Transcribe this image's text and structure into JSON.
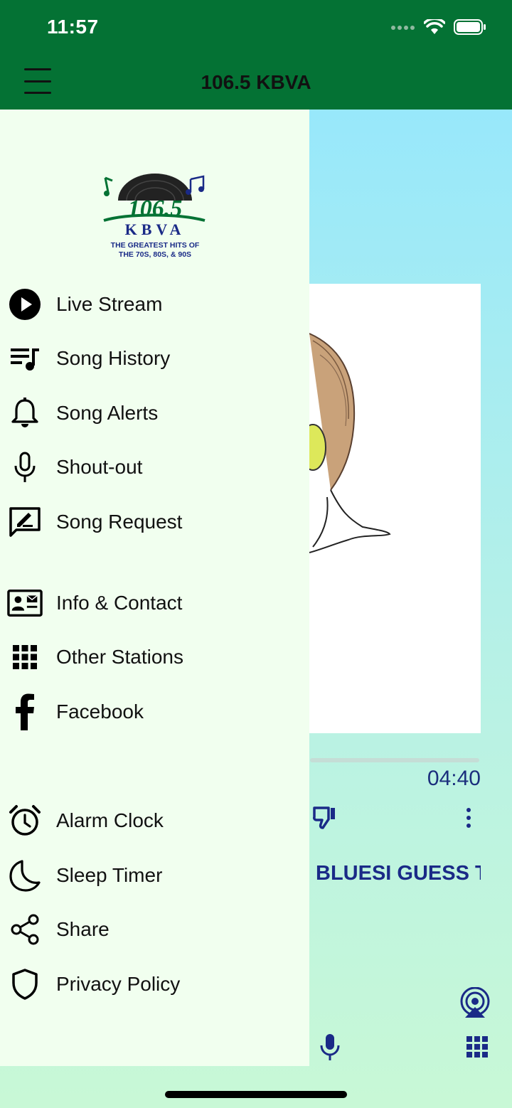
{
  "status_bar": {
    "time": "11:57"
  },
  "header": {
    "title": "106.5 KBVA"
  },
  "player": {
    "duration": "04:40",
    "song_title": "BLUESI GUESS THAT'S WHY THEY CALL IT THE BLUES"
  },
  "drawer": {
    "logo": {
      "line1": "106.5",
      "line2": "KBVA",
      "tagline1": "THE GREATEST HITS OF",
      "tagline2": "THE 70S, 80S, & 90S"
    },
    "items": [
      {
        "label": "Live Stream",
        "icon": "play-circle-icon"
      },
      {
        "label": "Song History",
        "icon": "playlist-icon"
      },
      {
        "label": "Song Alerts",
        "icon": "bell-icon"
      },
      {
        "label": "Shout-out",
        "icon": "microphone-icon"
      },
      {
        "label": "Song Request",
        "icon": "edit-message-icon"
      },
      {
        "label": "Info & Contact",
        "icon": "contact-card-icon"
      },
      {
        "label": "Other Stations",
        "icon": "grid-icon"
      },
      {
        "label": "Facebook",
        "icon": "facebook-icon"
      },
      {
        "label": "Alarm Clock",
        "icon": "alarm-clock-icon"
      },
      {
        "label": "Sleep Timer",
        "icon": "moon-icon"
      },
      {
        "label": "Share",
        "icon": "share-icon"
      },
      {
        "label": "Privacy Policy",
        "icon": "shield-icon"
      }
    ]
  },
  "colors": {
    "header_green": "#047234",
    "drawer_bg": "#f1ffef",
    "accent_navy": "#1a2a87"
  }
}
